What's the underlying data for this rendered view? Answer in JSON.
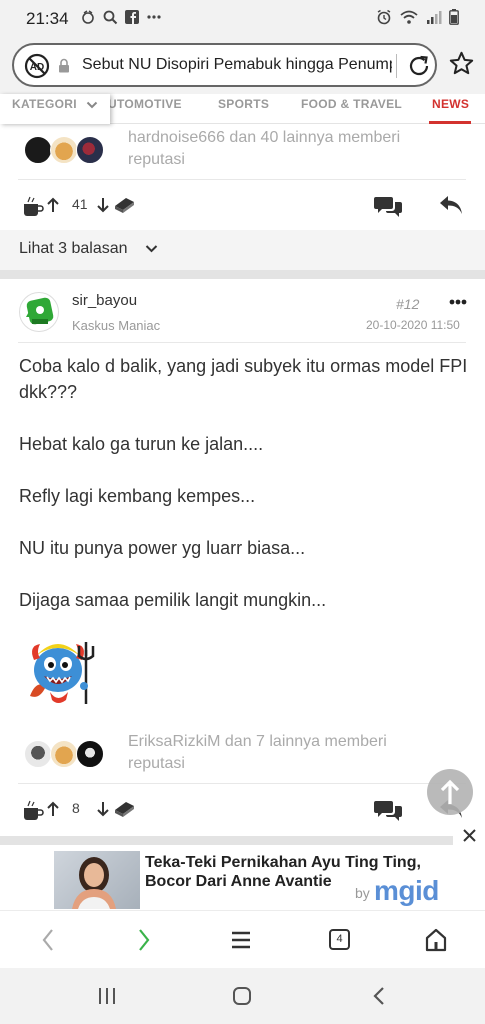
{
  "status_bar": {
    "time": "21:34"
  },
  "address_bar": {
    "url_text": "Sebut NU Disopiri Pemabuk hingga Penump"
  },
  "category_tabs": {
    "dropdown_label": "KATEGORI",
    "tabs": [
      "UTOMOTIVE",
      "SPORTS",
      "FOOD & TRAVEL",
      "NEWS"
    ],
    "active_tab": "NEWS"
  },
  "prev_post": {
    "reputation_text": "hardnoise666 dan 40 lainnya memberi reputasi",
    "vote_count": "41",
    "replies_label": "Lihat 3 balasan"
  },
  "post": {
    "username": "sir_bayou",
    "rank": "Kaskus Maniac",
    "number": "#12",
    "date": "20-10-2020 11:50",
    "body": [
      "Coba kalo d balik, yang jadi subyek itu ormas model FPI dkk???",
      "Hebat kalo ga turun ke jalan....",
      "Refly lagi kembang kempes...",
      "NU itu punya power yg luarr biasa...",
      "Dijaga samaa pemilik langit mungkin..."
    ],
    "reputation_text": "EriksaRizkiM dan 7 lainnya memberi reputasi",
    "vote_count": "8"
  },
  "ad": {
    "title": "Teka-Teki Pernikahan Ayu Ting Ting, Bocor Dari Anne Avantie",
    "by": "by",
    "brand": "mgid"
  },
  "browser_nav": {
    "tab_count": "4"
  },
  "colors": {
    "accent_red": "#d3322f",
    "mgid_blue": "#5a8fd6",
    "forward_green": "#3bb34a"
  }
}
